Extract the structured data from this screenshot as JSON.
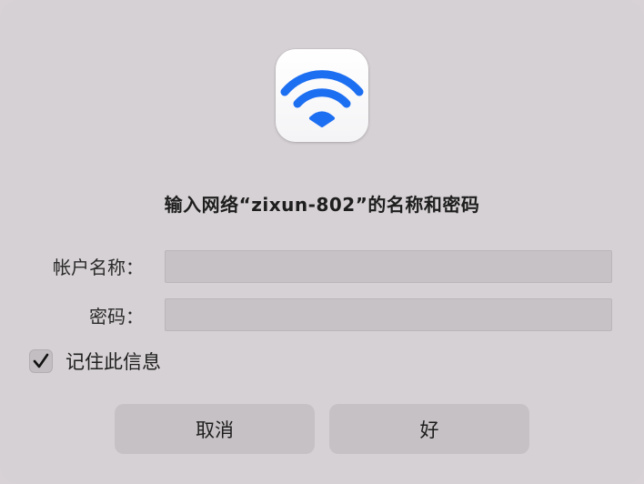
{
  "dialog": {
    "title": "输入网络“zixun-802”的名称和密码",
    "icon": "wifi-icon",
    "accent_color": "#1d6ff2"
  },
  "form": {
    "account_label": "帐户名称：",
    "account_value": "",
    "password_label": "密码：",
    "password_value": ""
  },
  "remember": {
    "label": "记住此信息",
    "checked": true
  },
  "buttons": {
    "cancel_label": "取消",
    "ok_label": "好"
  }
}
